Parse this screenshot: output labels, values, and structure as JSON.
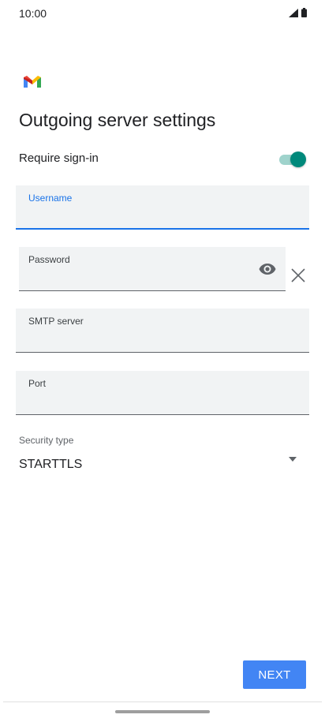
{
  "status_bar": {
    "time": "10:00",
    "icons": [
      "signal-icon",
      "battery-icon"
    ]
  },
  "app": {
    "logo": "gmail-logo",
    "title": "Outgoing server settings"
  },
  "require_signin": {
    "label": "Require sign-in",
    "enabled": true
  },
  "fields": {
    "username": {
      "label": "Username",
      "value": "",
      "focused": true
    },
    "password": {
      "label": "Password",
      "value": "",
      "visibility_icon": "eye-icon",
      "clear_icon": "close-icon"
    },
    "smtp_server": {
      "label": "SMTP server",
      "value": ""
    },
    "port": {
      "label": "Port",
      "value": ""
    }
  },
  "security": {
    "label": "Security type",
    "selected": "STARTTLS",
    "icon": "dropdown-arrow-icon"
  },
  "actions": {
    "next_label": "NEXT"
  },
  "colors": {
    "accent": "#1a73e8",
    "toggle_on": "#00897b",
    "button": "#4285f4",
    "field_background": "#f1f3f4"
  }
}
